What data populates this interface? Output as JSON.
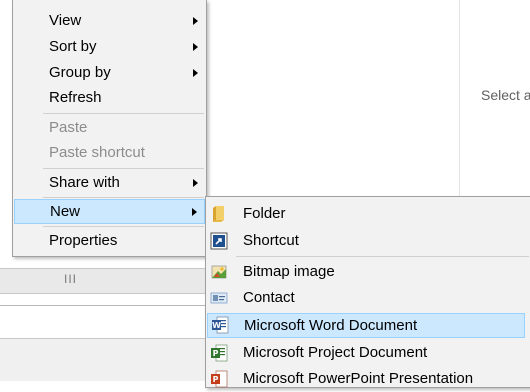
{
  "preview_pane": {
    "text": "Select a"
  },
  "statusbar": {
    "grip": "III"
  },
  "context_menu": {
    "items": [
      {
        "label": "View"
      },
      {
        "label": "Sort by"
      },
      {
        "label": "Group by"
      },
      {
        "label": "Refresh"
      },
      {
        "label": "Paste"
      },
      {
        "label": "Paste shortcut"
      },
      {
        "label": "Share with"
      },
      {
        "label": "New"
      },
      {
        "label": "Properties"
      }
    ]
  },
  "new_submenu": {
    "items": [
      {
        "label": "Folder",
        "icon": "folder-icon"
      },
      {
        "label": "Shortcut",
        "icon": "shortcut-icon"
      },
      {
        "label": "Bitmap image",
        "icon": "bitmap-image-icon"
      },
      {
        "label": "Contact",
        "icon": "contact-card-icon"
      },
      {
        "label": "Microsoft Word Document",
        "icon": "word-document-icon"
      },
      {
        "label": "Microsoft Project Document",
        "icon": "project-document-icon"
      },
      {
        "label": "Microsoft PowerPoint Presentation",
        "icon": "powerpoint-icon"
      }
    ]
  },
  "colors": {
    "highlight_bg": "#cce8ff",
    "highlight_border": "#99d1ff",
    "menu_bg": "#f2f2f2"
  }
}
